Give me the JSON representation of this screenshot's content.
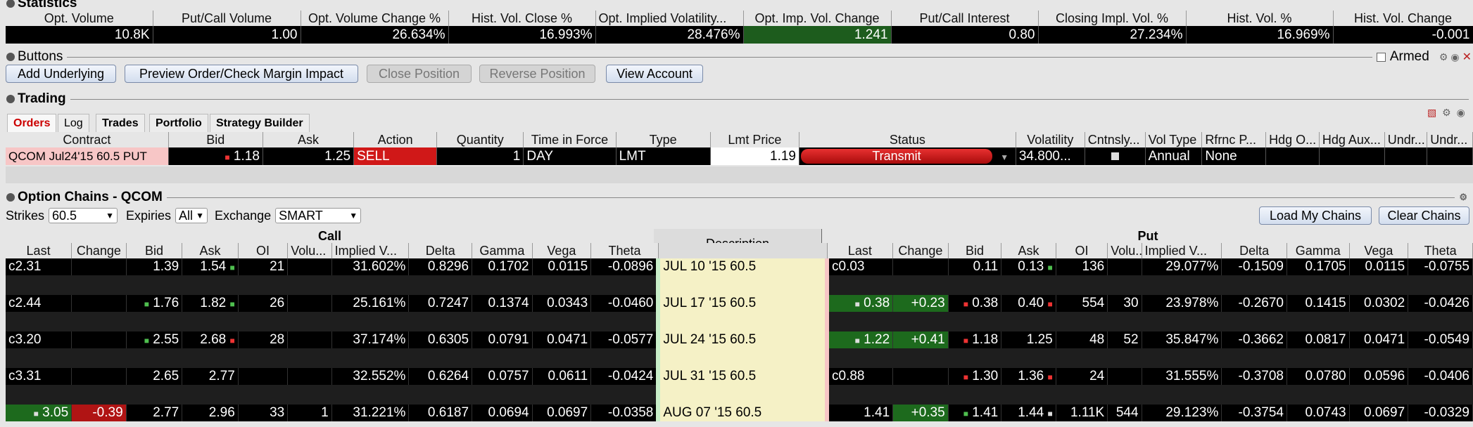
{
  "statistics": {
    "title": "Statistics",
    "headers": [
      "Opt. Volume",
      "Put/Call Volume",
      "Opt. Volume Change %",
      "Hist. Vol. Close %",
      "Opt. Implied Volatility...",
      "Opt. Imp. Vol. Change",
      "Put/Call Interest",
      "Closing Impl. Vol. %",
      "Hist. Vol. %",
      "Hist. Vol. Change"
    ],
    "values": [
      "10.8K",
      "1.00",
      "26.634%",
      "16.993%",
      "28.476%",
      "1.241",
      "0.80",
      "27.234%",
      "16.969%",
      "-0.001"
    ]
  },
  "buttons_panel": {
    "title": "Buttons",
    "armed_label": "Armed",
    "add_underlying": "Add Underlying",
    "preview_order": "Preview Order/Check Margin Impact",
    "close_position": "Close Position",
    "reverse_position": "Reverse Position",
    "view_account": "View Account"
  },
  "trading": {
    "title": "Trading",
    "tabs": [
      "Orders",
      "Log",
      "Trades",
      "Portfolio",
      "Strategy Builder"
    ],
    "headers": [
      "Contract",
      "Bid",
      "Ask",
      "Action",
      "Quantity",
      "Time in Force",
      "Type",
      "Lmt Price",
      "Status",
      "Volatility",
      "Cntnsly...",
      "Vol Type",
      "Rfrnc P...",
      "Hdg O...",
      "Hdg Aux...",
      "Undr...",
      "Undr..."
    ],
    "order": {
      "contract": "QCOM Jul24'15 60.5 PUT",
      "bid": "1.18",
      "ask": "1.25",
      "action": "SELL",
      "quantity": "1",
      "tif": "DAY",
      "type": "LMT",
      "lmt_price": "1.19",
      "status": "Transmit",
      "volatility": "34.800...",
      "vol_type": "Annual",
      "ref_price": "None"
    }
  },
  "option_chains": {
    "title": "Option Chains - QCOM",
    "strikes_label": "Strikes",
    "strikes_value": "60.5",
    "expiries_label": "Expiries",
    "expiries_value": "All",
    "exchange_label": "Exchange",
    "exchange_value": "SMART",
    "load_chains": "Load My Chains",
    "clear_chains": "Clear Chains",
    "call_label": "Call",
    "put_label": "Put",
    "description_label": "Description",
    "side_headers": [
      "Last",
      "Change",
      "Bid",
      "Ask",
      "OI",
      "Volu...",
      "Implied V...",
      "Delta",
      "Gamma",
      "Vega",
      "Theta"
    ],
    "rows": [
      {
        "call": [
          "c2.31",
          "",
          "1.39",
          "1.54",
          "21",
          "",
          "31.602%",
          "0.8296",
          "0.1702",
          "0.0115",
          "-0.0896"
        ],
        "desc": "JUL 10 '15 60.5",
        "put": [
          "c0.03",
          "",
          "0.11",
          "0.13",
          "136",
          "",
          "29.077%",
          "-0.1509",
          "0.1705",
          "0.0115",
          "-0.0755"
        ]
      },
      {
        "call": [
          "c2.44",
          "",
          "1.76",
          "1.82",
          "26",
          "",
          "25.161%",
          "0.7247",
          "0.1374",
          "0.0343",
          "-0.0460"
        ],
        "desc": "JUL 17 '15 60.5",
        "put": [
          "0.38",
          "+0.23",
          "0.38",
          "0.40",
          "554",
          "30",
          "23.978%",
          "-0.2670",
          "0.1415",
          "0.0302",
          "-0.0426"
        ]
      },
      {
        "call": [
          "c3.20",
          "",
          "2.55",
          "2.68",
          "28",
          "",
          "37.174%",
          "0.6305",
          "0.0791",
          "0.0471",
          "-0.0577"
        ],
        "desc": "JUL 24 '15 60.5",
        "put": [
          "1.22",
          "+0.41",
          "1.18",
          "1.25",
          "48",
          "52",
          "35.847%",
          "-0.3662",
          "0.0817",
          "0.0471",
          "-0.0549"
        ]
      },
      {
        "call": [
          "c3.31",
          "",
          "2.65",
          "2.77",
          "",
          "",
          "32.552%",
          "0.6264",
          "0.0757",
          "0.0611",
          "-0.0424"
        ],
        "desc": "JUL 31 '15 60.5",
        "put": [
          "c0.88",
          "",
          "1.30",
          "1.36",
          "24",
          "",
          "31.555%",
          "-0.3708",
          "0.0780",
          "0.0596",
          "-0.0406"
        ]
      },
      {
        "call": [
          "3.05",
          "-0.39",
          "2.77",
          "2.96",
          "33",
          "1",
          "31.221%",
          "0.6187",
          "0.0694",
          "0.0697",
          "-0.0358"
        ],
        "desc": "AUG 07 '15 60.5",
        "put": [
          "1.41",
          "+0.35",
          "1.41",
          "1.44",
          "1.11K",
          "544",
          "29.123%",
          "-0.3754",
          "0.0743",
          "0.0697",
          "-0.0329"
        ]
      }
    ]
  },
  "colors": {
    "up": "#1d6a1d",
    "down": "#b01414",
    "implied_vol": "#f49aa0",
    "description_bg": "#f5f1c6"
  }
}
